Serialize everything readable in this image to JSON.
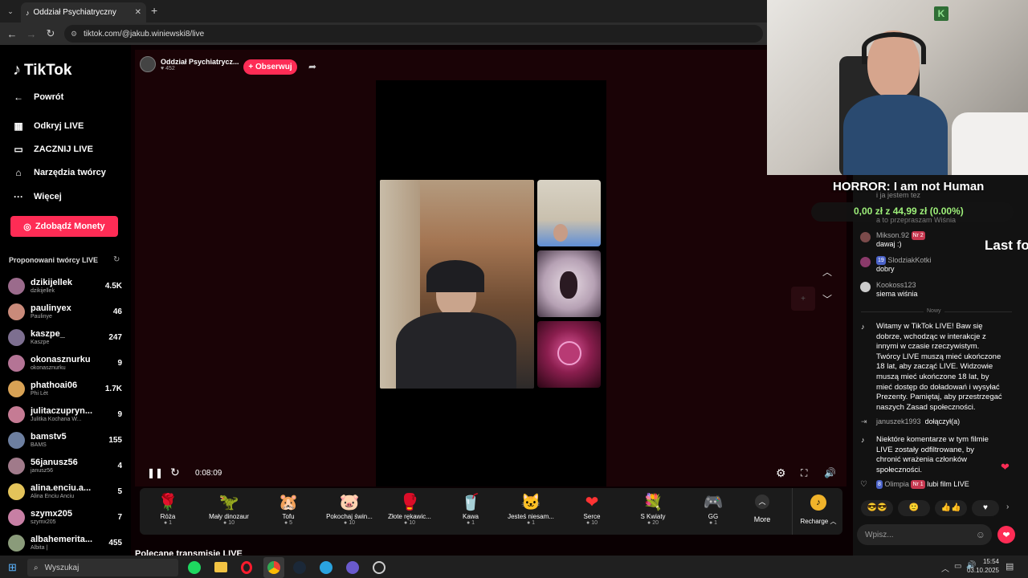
{
  "browser": {
    "tab_title": "Oddział Psychiatryczny",
    "url": "tiktok.com/@jakub.winiewski8/live"
  },
  "sidebar": {
    "logo": "TikTok",
    "back": "Powrót",
    "items": [
      {
        "label": "Odkryj LIVE",
        "icon": "calendar-icon"
      },
      {
        "label": "ZACZNIJ LIVE",
        "icon": "camera-icon"
      },
      {
        "label": "Narzędzia twórcy",
        "icon": "house-icon"
      },
      {
        "label": "Więcej",
        "icon": "more-icon"
      }
    ],
    "coins_button": "Zdobądź Monety",
    "suggested_title": "Proponowani twórcy LIVE",
    "creators": [
      {
        "name": "dzikijellek",
        "sub": "dzikijellek",
        "count": "4.5K"
      },
      {
        "name": "paulinyex",
        "sub": "Paulinye",
        "count": "46"
      },
      {
        "name": "kaszpe_",
        "sub": "Kaszpe",
        "count": "247"
      },
      {
        "name": "okonasznurku",
        "sub": "okonasznurku",
        "count": "9"
      },
      {
        "name": "phathoai06",
        "sub": "Phi Lèt",
        "count": "1.7K"
      },
      {
        "name": "julitaczupryn...",
        "sub": "Julitka Kochana W...",
        "count": "9"
      },
      {
        "name": "bamstv5",
        "sub": "BAMS",
        "count": "155"
      },
      {
        "name": "56janusz56",
        "sub": "janusz56",
        "count": "4"
      },
      {
        "name": "alina.enciu.a...",
        "sub": "Alina Enciu Anciu",
        "count": "5"
      },
      {
        "name": "szymx205",
        "sub": "szymx205",
        "count": "7"
      },
      {
        "name": "albahemerita...",
        "sub": "Albita |",
        "count": "455"
      }
    ]
  },
  "host": {
    "name": "Oddział Psychiatrycz...",
    "likes": "452",
    "follow_label": "+ Obserwuj"
  },
  "player": {
    "time": "0:08:09"
  },
  "gifts": [
    {
      "name": "Róża",
      "price": "1",
      "icon": "🌹"
    },
    {
      "name": "Mały dinozaur",
      "price": "10",
      "icon": "🦖"
    },
    {
      "name": "Tofu",
      "price": "5",
      "icon": "🐹"
    },
    {
      "name": "Pokochaj świn...",
      "price": "10",
      "icon": "🐷"
    },
    {
      "name": "Złote rękawic...",
      "price": "10",
      "icon": "🥊"
    },
    {
      "name": "Kawa",
      "price": "1",
      "icon": "🥤"
    },
    {
      "name": "Jesteś niesam...",
      "price": "1",
      "icon": "🐱"
    },
    {
      "name": "Serce",
      "price": "10",
      "icon": "❤"
    },
    {
      "name": "S Kwiaty",
      "price": "20",
      "icon": "💐"
    },
    {
      "name": "GG",
      "price": "1",
      "icon": "🎮"
    }
  ],
  "gifts_more": "More",
  "recharge": "Recharge",
  "recommended_title": "Polecane transmisje LIVE",
  "overlay": {
    "horror_title": "HORROR: I am not Human",
    "money": "0,00 zł z 44,99 zł (0.00%)",
    "last": "Last fo"
  },
  "chat": {
    "faded_top1": "i ja jestem tez",
    "faded_top2": "a to przepraszam Wiśnia",
    "messages": [
      {
        "user": "Mikson.92",
        "badge": "Nr 2",
        "text": "dawaj :)"
      },
      {
        "user": "SlodziakKotki",
        "badge": "19",
        "text": "dobry"
      },
      {
        "user": "Kookoss123",
        "badge": "",
        "text": "siema wiśnia"
      }
    ],
    "new_label": "Nowy",
    "welcome": "Witamy w TikTok LIVE! Baw się dobrze, wchodząc w interakcje z innymi w czasie rzeczywistym. Twórcy LIVE muszą mieć ukończone 18 lat, aby zacząć LIVE. Widzowie muszą mieć ukończone 18 lat, by mieć dostęp do doładowań i wysyłać Prezenty. Pamiętaj, aby przestrzegać naszych Zasad społeczności.",
    "joined_user": "januszek1993",
    "joined_text": "dołączył(a)",
    "filtered": "Niektóre komentarze w tym filmie LIVE zostały odfiltrowane, by chronić wrażenia członków społeczności.",
    "olimpia_user": "Olimpia",
    "olimpia_badge1": "8",
    "olimpia_badge2": "Nr 1",
    "olimpia_text": "lubi film LIVE",
    "input_placeholder": "Wpisz..."
  },
  "taskbar": {
    "search": "Wyszukaj",
    "time": "15:54",
    "date": "03.10.2025"
  }
}
